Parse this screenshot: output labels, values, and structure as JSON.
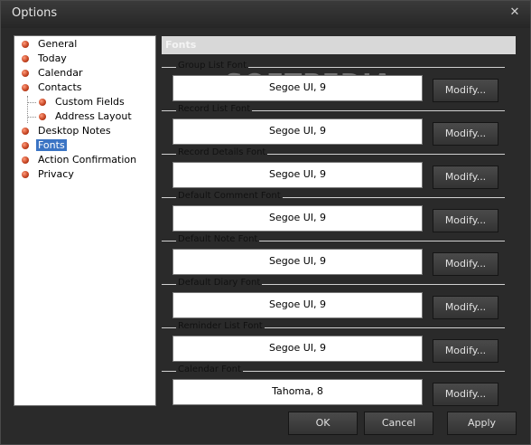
{
  "window": {
    "title": "Options",
    "close_glyph": "✕"
  },
  "sidebar": {
    "items": [
      {
        "label": "General"
      },
      {
        "label": "Today"
      },
      {
        "label": "Calendar"
      },
      {
        "label": "Contacts"
      },
      {
        "label": "Custom Fields"
      },
      {
        "label": "Address Layout"
      },
      {
        "label": "Desktop Notes"
      },
      {
        "label": "Fonts"
      },
      {
        "label": "Action Confirmation"
      },
      {
        "label": "Privacy"
      }
    ],
    "selected": "Fonts"
  },
  "panel": {
    "header": "Fonts",
    "groups": [
      {
        "legend": "Group List Font",
        "value": "Segoe UI, 9",
        "button": "Modify..."
      },
      {
        "legend": "Record List Font",
        "value": "Segoe UI, 9",
        "button": "Modify..."
      },
      {
        "legend": "Record Details Font",
        "value": "Segoe UI, 9",
        "button": "Modify..."
      },
      {
        "legend": "Default Comment Font",
        "value": "Segoe UI, 9",
        "button": "Modify..."
      },
      {
        "legend": "Default Note Font",
        "value": "Segoe UI, 9",
        "button": "Modify..."
      },
      {
        "legend": "Default Diary Font",
        "value": "Segoe UI, 9",
        "button": "Modify..."
      },
      {
        "legend": "Reminder List Font",
        "value": "Segoe UI, 9",
        "button": "Modify..."
      },
      {
        "legend": "Calendar Font",
        "value": "Tahoma, 8",
        "button": "Modify..."
      }
    ]
  },
  "footer": {
    "ok": "OK",
    "cancel": "Cancel",
    "apply": "Apply"
  },
  "watermark": "SOFTPEDIA",
  "colors": {
    "selected_bg": "#3b74c4",
    "bullet": "#c2401e",
    "window_bg": "#2a2a2a"
  }
}
